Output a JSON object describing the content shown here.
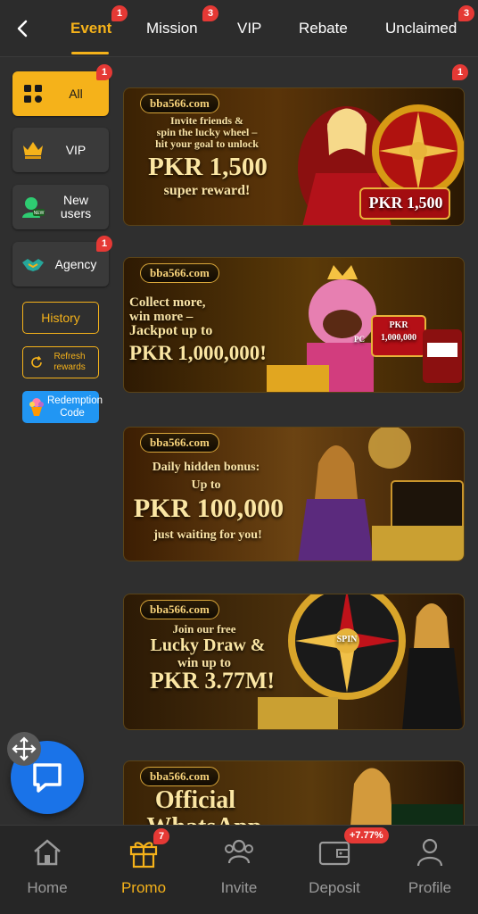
{
  "tabs": [
    {
      "label": "Event",
      "badge": "1",
      "active": true
    },
    {
      "label": "Mission",
      "badge": "3"
    },
    {
      "label": "VIP",
      "badge": ""
    },
    {
      "label": "Rebate",
      "badge": ""
    },
    {
      "label": "Unclaimed",
      "badge": "3"
    }
  ],
  "sidebar": {
    "items": [
      {
        "label": "All",
        "badge": "1",
        "active": true,
        "icon": "grid-icon"
      },
      {
        "label": "VIP",
        "badge": "",
        "icon": "crown-icon"
      },
      {
        "label": "New users",
        "badge": "",
        "icon": "new-user-icon"
      },
      {
        "label": "Agency",
        "badge": "1",
        "icon": "handshake-icon"
      }
    ],
    "history_label": "History",
    "refresh_label": "Refresh rewards",
    "redeem_label": "Redemption Code"
  },
  "banners": [
    {
      "logo": "bba566.com",
      "line1": "Invite friends &",
      "line2": "spin the lucky wheel –",
      "line3": "hit your goal to unlock",
      "amount": "PKR 1,500",
      "line4": "super reward!",
      "tag": "PKR 1,500",
      "badge": "1"
    },
    {
      "logo": "bba566.com",
      "line1": "Collect more,",
      "line2": "win more –",
      "line3": "Jackpot up to",
      "amount": "PKR 1,000,000!",
      "tag_top": "PKR",
      "tag": "1,000,000",
      "chip": "PC"
    },
    {
      "logo": "bba566.com",
      "line1": "Daily hidden bonus:",
      "line2": "Up to",
      "amount": "PKR 100,000",
      "line3": "just waiting for you!"
    },
    {
      "logo": "bba566.com",
      "line1": "Join our free",
      "line2": "Lucky Draw &",
      "line3": "win up to",
      "amount": "PKR 3.77M!",
      "wheel_center": "SPIN"
    },
    {
      "logo": "bba566.com",
      "line1": "Official",
      "line2": "WhatsApp"
    }
  ],
  "bottom_nav": [
    {
      "label": "Home",
      "icon": "home-icon"
    },
    {
      "label": "Promo",
      "icon": "gift-icon",
      "badge": "7",
      "active": true
    },
    {
      "label": "Invite",
      "icon": "invite-icon"
    },
    {
      "label": "Deposit",
      "icon": "wallet-icon",
      "badge": "+7.77%"
    },
    {
      "label": "Profile",
      "icon": "profile-icon"
    }
  ],
  "colors": {
    "accent": "#f5b21a",
    "badge": "#e53935",
    "background": "#2f2f2f",
    "chat": "#1a73e8"
  }
}
